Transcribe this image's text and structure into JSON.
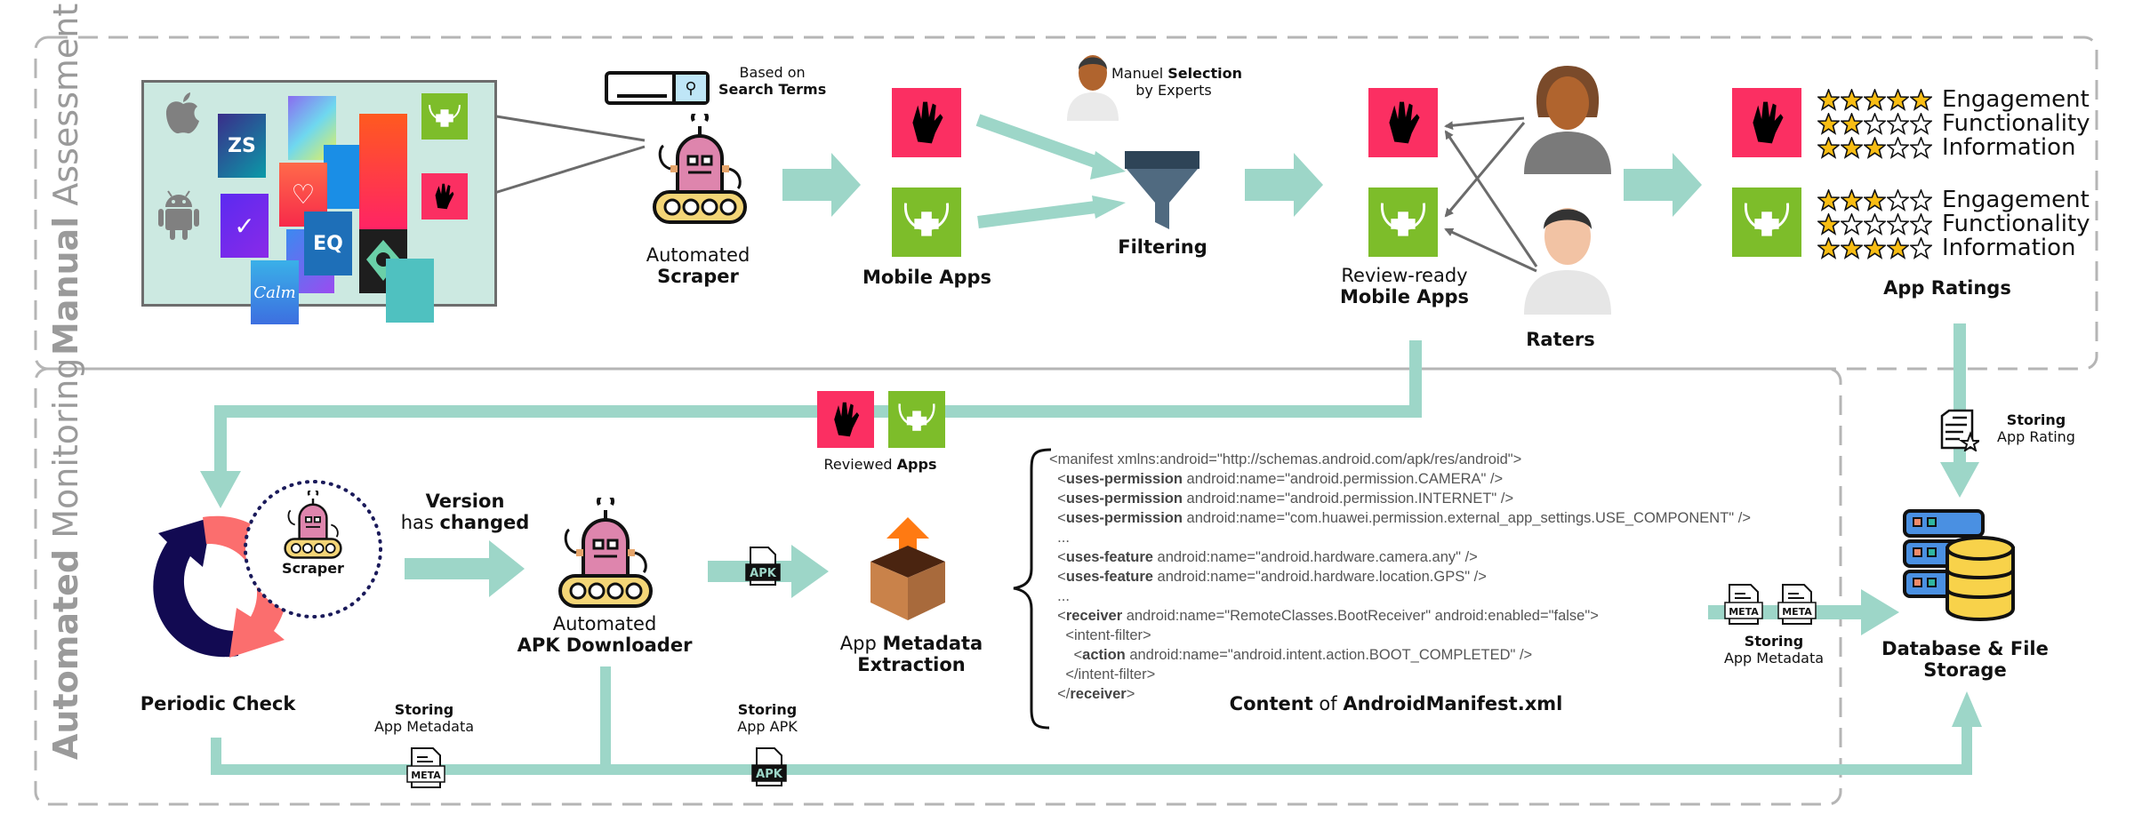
{
  "sections": {
    "manual": {
      "bold": "Manual",
      "rest": " Assessment"
    },
    "automated": {
      "bold": "Automated",
      "rest": " Monitoring"
    }
  },
  "colors": {
    "flow_arrow": "#9dd6c8",
    "section_border": "#b5b5b5",
    "app_pink": "#fb2f62",
    "app_green": "#7dbd2a",
    "collage_bg": "#cce9e1",
    "cycle_navy": "#120a52",
    "cycle_coral": "#fb6e6e",
    "star_fill": "#f8bd14"
  },
  "manual_assessment": {
    "app_stores": [
      "apple-logo",
      "android-logo"
    ],
    "collage_apps": [
      "ZS",
      "Calm",
      "EQ"
    ],
    "search": {
      "line1": "Based on",
      "line2": "Search Terms"
    },
    "scraper": {
      "line1": "Automated",
      "line2": "Scraper"
    },
    "mobile_apps": {
      "label": "Mobile Apps"
    },
    "expert": {
      "text_normal": "Manuel ",
      "text_bold": "Selection",
      "line2": "by Experts"
    },
    "filtering": {
      "label": "Filtering"
    },
    "review_ready": {
      "line1": "Review-ready",
      "line2": "Mobile Apps"
    },
    "raters": {
      "label": "Raters"
    },
    "app_ratings": {
      "title": "App Ratings",
      "max_stars": 5,
      "apps": [
        {
          "icon": "hand-care-app",
          "color": "pink",
          "ratings": [
            {
              "criterion": "Engagement",
              "stars": 5
            },
            {
              "criterion": "Functionality",
              "stars": 2
            },
            {
              "criterion": "Information",
              "stars": 3
            }
          ]
        },
        {
          "icon": "nutrition-health-app",
          "color": "green",
          "ratings": [
            {
              "criterion": "Engagement",
              "stars": 3
            },
            {
              "criterion": "Functionality",
              "stars": 1
            },
            {
              "criterion": "Information",
              "stars": 4
            }
          ]
        }
      ]
    }
  },
  "automated_monitoring": {
    "reviewed_apps": {
      "normal": "Reviewed ",
      "bold": "Apps"
    },
    "periodic_check": {
      "label": "Periodic Check"
    },
    "scraper_badge": {
      "label": "Scraper"
    },
    "version_changed": {
      "line1": "Version",
      "line2_normal": "has ",
      "line2_bold": "changed"
    },
    "apk_downloader": {
      "line1": "Automated",
      "line2": "APK Downloader"
    },
    "apk_file_badge": "APK",
    "meta_file_badge": "META",
    "metadata_extraction": {
      "line1_normal": "App ",
      "line1_bold": "Metadata",
      "line2": "Extraction"
    },
    "manifest": {
      "caption_bold1": "Content",
      "caption_normal": " of ",
      "caption_bold2": "AndroidManifest.xml",
      "lines": [
        {
          "indent": 0,
          "pre": "<manifest xmlns:android=\"http://schemas.android.com/apk/res/android\">",
          "tag": "",
          "post": ""
        },
        {
          "indent": 1,
          "pre": "<",
          "tag": "uses-permission",
          "post": " android:name=\"android.permission.CAMERA\" />"
        },
        {
          "indent": 1,
          "pre": "<",
          "tag": "uses-permission",
          "post": " android:name=\"android.permission.INTERNET\" />"
        },
        {
          "indent": 1,
          "pre": "<",
          "tag": "uses-permission",
          "post": " android:name=\"com.huawei.permission.external_app_settings.USE_COMPONENT\" />"
        },
        {
          "indent": 1,
          "pre": "...",
          "tag": "",
          "post": ""
        },
        {
          "indent": 1,
          "pre": "<",
          "tag": "uses-feature",
          "post": " android:name=\"android.hardware.camera.any\" />"
        },
        {
          "indent": 1,
          "pre": "<",
          "tag": "uses-feature",
          "post": " android:name=\"android.hardware.location.GPS\" />"
        },
        {
          "indent": 1,
          "pre": "...",
          "tag": "",
          "post": ""
        },
        {
          "indent": 1,
          "pre": "<",
          "tag": "receiver",
          "post": " android:name=\"RemoteClasses.BootReceiver\" android:enabled=\"false\">"
        },
        {
          "indent": 2,
          "pre": "<intent-filter>",
          "tag": "",
          "post": ""
        },
        {
          "indent": 3,
          "pre": "<",
          "tag": "action",
          "post": " android:name=\"android.intent.action.BOOT_COMPLETED\" />"
        },
        {
          "indent": 2,
          "pre": "</intent-filter>",
          "tag": "",
          "post": ""
        },
        {
          "indent": 1,
          "pre": "</",
          "tag": "receiver",
          "post": ">"
        }
      ]
    },
    "storing_metadata_left": {
      "line1": "Storing",
      "line2": "App Metadata"
    },
    "storing_apk": {
      "line1": "Storing",
      "line2": "App APK"
    },
    "storing_metadata_right": {
      "line1": "Storing",
      "line2": "App Metadata"
    }
  },
  "storage": {
    "storing_rating": {
      "line1": "Storing",
      "line2": "App Rating"
    },
    "database": {
      "line1": "Database & File",
      "line2": "Storage"
    }
  }
}
